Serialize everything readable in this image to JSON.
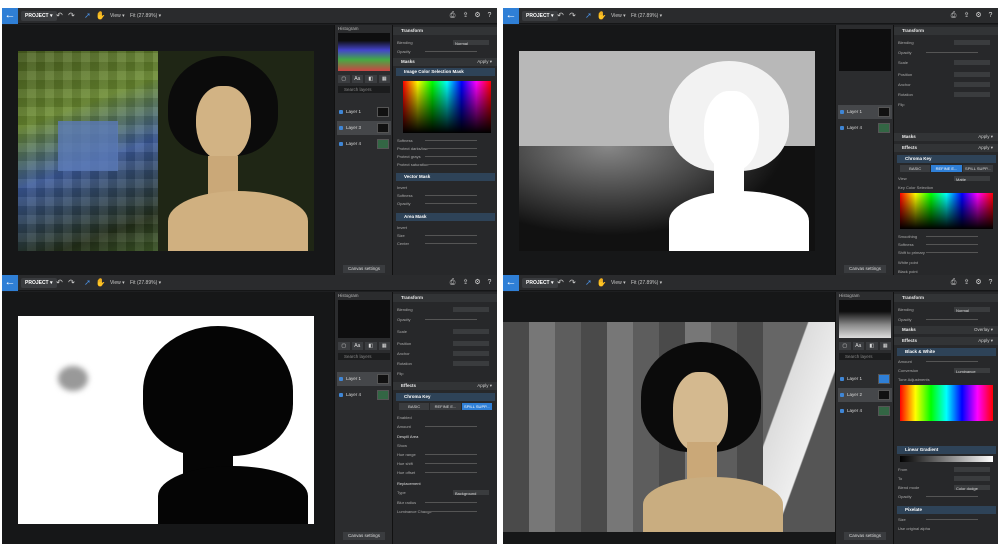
{
  "common": {
    "project_label": "PROJECT ▾",
    "view_label": "View ▾",
    "fit_label": "Fit (27.89%) ▾",
    "histogram_label": "Histogram",
    "search_placeholder": "Search layers",
    "canvas_settings": "Canvas settings",
    "transform_label": "Transform",
    "apply_label": "Apply ▾",
    "icon_tabs": [
      "▢",
      "Aa",
      "◧",
      "▦"
    ]
  },
  "q1": {
    "layers": [
      "Layer 1",
      "Layer 3",
      "Layer 4"
    ],
    "props": {
      "blending_label": "Blending",
      "blending_value": "Normal",
      "opacity_label": "Opacity",
      "masks_label": "Masks",
      "mask1_title": "Image Color Selection Mask",
      "mask1_rows": [
        "Softness",
        "Protect darks/low",
        "Protect grays",
        "Protect saturation"
      ],
      "mask2_title": "Vector Mask",
      "mask2_rows": [
        "Invert",
        "Softness",
        "Opacity"
      ],
      "mask3_title": "Area Mask",
      "mask3_rows": [
        "Invert",
        "Size",
        "Center"
      ]
    }
  },
  "q2": {
    "layers": [
      "Layer 1",
      "Layer 4"
    ],
    "props": {
      "rows": [
        "Blending",
        "Opacity",
        "Scale",
        "Position",
        "Anchor",
        "Rotation",
        "Flip"
      ],
      "masks_label": "Masks",
      "effects_label": "Effects",
      "effect_title": "Chroma Key",
      "tabs": [
        "BASIC",
        "REFINE E...",
        "SPILL SUPP..."
      ],
      "view_label": "View",
      "view_value": "Matte",
      "key_color_label": "Key Color Selection",
      "bottom_rows": [
        "Smoothing",
        "Softness",
        "Shift to primary",
        "White point",
        "Black point"
      ]
    }
  },
  "q3": {
    "layers": [
      "Layer 1",
      "Layer 4"
    ],
    "props": {
      "rows": [
        "Blending",
        "Opacity",
        "Scale",
        "Position",
        "Anchor",
        "Rotation",
        "Flip"
      ],
      "effects_label": "Effects",
      "effect_title": "Chroma Key",
      "tabs": [
        "BASIC",
        "REFINE E...",
        "SPILL SUPP..."
      ],
      "rows2": [
        "Enabled",
        "Amount",
        "Despill Area",
        "Show",
        "Hue range",
        "Hue shift",
        "Hue offset",
        "Replacement",
        "Type",
        "Blur radius",
        "Luminance Change"
      ],
      "type_value": "Background"
    }
  },
  "q4": {
    "layers": [
      "Layer 1",
      "Layer 2",
      "Layer 4"
    ],
    "props": {
      "rows": [
        "Blending",
        "Opacity"
      ],
      "blending_value": "Normal",
      "masks_label": "Masks",
      "overlay_label": "Overlay ▾",
      "effects_label": "Effects",
      "effect1_title": "Black & White",
      "effect1_rows": [
        "Amount",
        "Conversion"
      ],
      "conversion_value": "Luminance",
      "tone_label": "Tone Adjustments",
      "effect2_title": "Linear Gradient",
      "effect2_rows": [
        "From",
        "To",
        "Blend mode",
        "Opacity"
      ],
      "blend_value": "Color dodge",
      "effect3_title": "Pixelate",
      "effect3_rows": [
        "Size",
        "Use original alpha"
      ]
    }
  }
}
